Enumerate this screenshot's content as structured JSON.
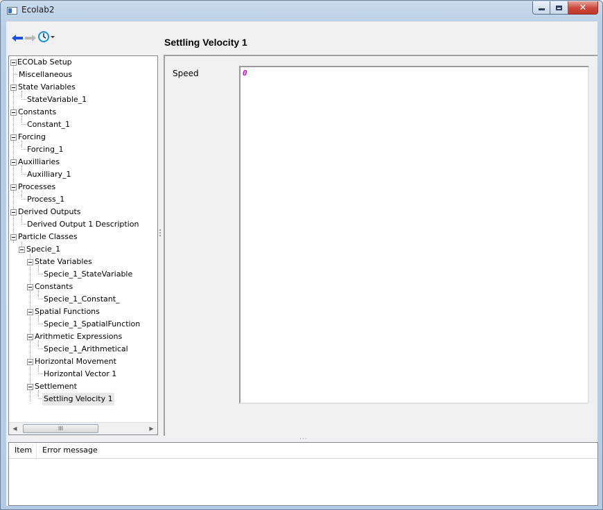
{
  "window": {
    "title": "Ecolab2"
  },
  "toolbar": {
    "back_icon": "arrow-left-icon",
    "forward_icon": "arrow-right-icon",
    "history_icon": "clock-icon"
  },
  "tree": {
    "items": [
      {
        "label": "ECOLab Setup"
      },
      {
        "label": "Miscellaneous"
      },
      {
        "label": "State Variables"
      },
      {
        "label": "StateVariable_1"
      },
      {
        "label": "Constants"
      },
      {
        "label": "Constant_1"
      },
      {
        "label": "Forcing"
      },
      {
        "label": "Forcing_1"
      },
      {
        "label": "Auxilliaries"
      },
      {
        "label": "Auxilliary_1"
      },
      {
        "label": "Processes"
      },
      {
        "label": "Process_1"
      },
      {
        "label": "Derived Outputs"
      },
      {
        "label": "Derived Output 1 Description"
      },
      {
        "label": "Particle Classes"
      },
      {
        "label": "Specie_1"
      },
      {
        "label": "State Variables"
      },
      {
        "label": "Specie_1_StateVariable"
      },
      {
        "label": "Constants"
      },
      {
        "label": "Specie_1_Constant_"
      },
      {
        "label": "Spatial Functions"
      },
      {
        "label": "Specie_1_SpatialFunction"
      },
      {
        "label": "Arithmetic Expressions"
      },
      {
        "label": "Specie_1_Arithmetical"
      },
      {
        "label": "Horizontal Movement"
      },
      {
        "label": "Horizontal Vector 1"
      },
      {
        "label": "Settlement"
      },
      {
        "label": "Settling Velocity 1"
      }
    ],
    "scroll_thumb": "III"
  },
  "detail": {
    "title": "Settling Velocity 1",
    "field_label": "Speed",
    "field_value": "0"
  },
  "errors": {
    "col_item": "Item",
    "col_message": "Error message"
  }
}
